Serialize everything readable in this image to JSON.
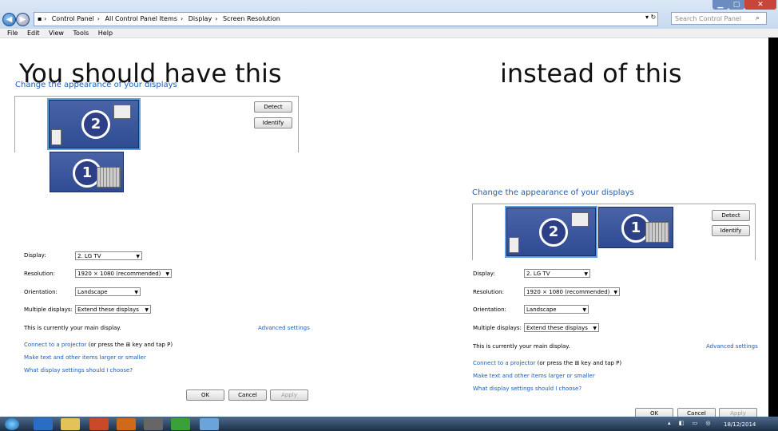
{
  "window": {
    "breadcrumb": [
      "Control Panel",
      "All Control Panel Items",
      "Display",
      "Screen Resolution"
    ],
    "search_placeholder": "Search Control Panel"
  },
  "menu": [
    "File",
    "Edit",
    "View",
    "Tools",
    "Help"
  ],
  "captions": {
    "left": "You should have this",
    "right": "instead of this"
  },
  "panel": {
    "heading": "Change the appearance of your displays",
    "detect_label": "Detect",
    "identify_label": "Identify",
    "monitor_1": "1",
    "monitor_2": "2",
    "display_label": "Display:",
    "display_value": "2. LG TV",
    "resolution_label": "Resolution:",
    "resolution_value": "1920 × 1080 (recommended)",
    "orientation_label": "Orientation:",
    "orientation_value": "Landscape",
    "multiple_label": "Multiple displays:",
    "multiple_value": "Extend these displays",
    "main_display_text": "This is currently your main display.",
    "advanced_link": "Advanced settings",
    "projector_link": "Connect to a projector",
    "projector_tail": "(or press the",
    "projector_tail2": "key and tap P)",
    "text_larger_link": "Make text and other items larger or smaller",
    "which_settings_link": "What display settings should I choose?",
    "ok_label": "OK",
    "cancel_label": "Cancel",
    "apply_label": "Apply"
  },
  "taskbar": {
    "date": "18/12/2014"
  }
}
